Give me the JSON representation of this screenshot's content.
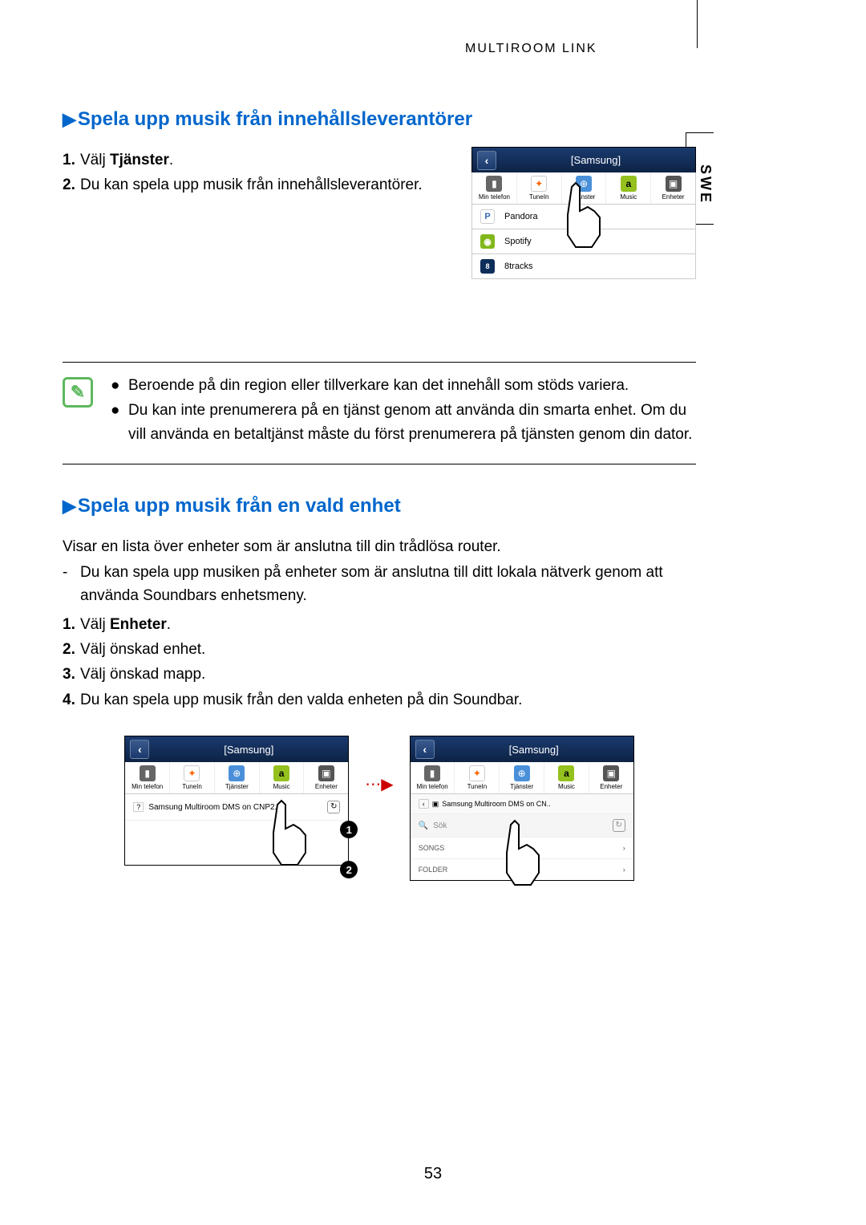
{
  "header": {
    "section": "Multiroom Link"
  },
  "sideTab": "SWE",
  "section1": {
    "heading": "Spela upp musik från innehållsleverantörer",
    "steps": [
      {
        "num": "1.",
        "prefix": "Välj ",
        "bold": "Tjänster",
        "suffix": "."
      },
      {
        "num": "2.",
        "text": "Du kan spela upp musik från innehållsleverantörer."
      }
    ]
  },
  "screenshot1": {
    "title": "[Samsung]",
    "nav": [
      "Min telefon",
      "TuneIn",
      "Tjänster",
      "Music",
      "Enheter"
    ],
    "services": [
      "Pandora",
      "Spotify",
      "8tracks"
    ]
  },
  "notes": {
    "items": [
      "Beroende på din region eller tillverkare kan det innehåll som stöds variera.",
      "Du kan inte prenumerera på en tjänst genom att använda din smarta enhet. Om du vill använda en betaltjänst måste du först prenumerera på tjänsten genom din dator."
    ]
  },
  "section2": {
    "heading": "Spela upp musik från en vald enhet",
    "intro": "Visar en lista över enheter som är anslutna till din trådlösa router.",
    "dash": "Du kan spela upp musiken på enheter som är anslutna till ditt lokala nätverk genom att använda Soundbars enhetsmeny.",
    "steps": [
      {
        "num": "1.",
        "prefix": "Välj ",
        "bold": "Enheter",
        "suffix": "."
      },
      {
        "num": "2.",
        "text": "Välj önskad enhet."
      },
      {
        "num": "3.",
        "text": "Välj önskad mapp."
      },
      {
        "num": "4.",
        "text": "Du kan spela upp musik från den valda enheten på din Soundbar."
      }
    ]
  },
  "screenshot2": {
    "title": "[Samsung]",
    "nav": [
      "Min telefon",
      "TuneIn",
      "Tjänster",
      "Music",
      "Enheter"
    ],
    "deviceRow": "Samsung Multiroom DMS on CNP2...",
    "callout1": "1",
    "callout2": "2"
  },
  "screenshot3": {
    "title": "[Samsung]",
    "nav": [
      "Min telefon",
      "TuneIn",
      "Tjänster",
      "Music",
      "Enheter"
    ],
    "crumb": "Samsung Multiroom DMS on CN..",
    "search": "Sök",
    "folders": [
      "SONGS",
      "FOLDER"
    ]
  },
  "pageNumber": "53"
}
